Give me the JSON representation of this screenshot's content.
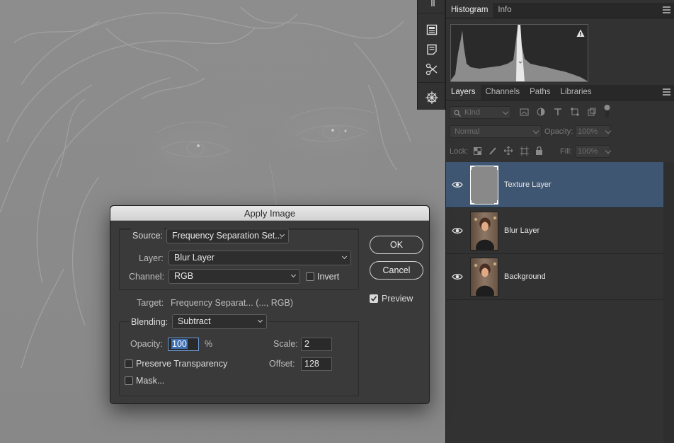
{
  "panels": {
    "histogram_tabs": [
      {
        "label": "Histogram",
        "active": true
      },
      {
        "label": "Info",
        "active": false
      }
    ],
    "layers_tabs": [
      {
        "label": "Layers",
        "active": true
      },
      {
        "label": "Channels",
        "active": false
      },
      {
        "label": "Paths",
        "active": false
      },
      {
        "label": "Libraries",
        "active": false
      }
    ],
    "filter_kind": "Kind",
    "blend_mode": "Normal",
    "opacity_label": "Opacity:",
    "opacity_value": "100%",
    "lock_label": "Lock:",
    "fill_label": "Fill:",
    "fill_value": "100%",
    "layers": [
      {
        "name": "Texture Layer",
        "selected": true,
        "thumb": "gray"
      },
      {
        "name": "Blur Layer",
        "selected": false,
        "thumb": "photo"
      },
      {
        "name": "Background",
        "selected": false,
        "thumb": "photo"
      }
    ]
  },
  "dialog": {
    "title": "Apply Image",
    "source_label": "Source:",
    "source_value": "Frequency Separation Set...",
    "layer_label": "Layer:",
    "layer_value": "Blur Layer",
    "channel_label": "Channel:",
    "channel_value": "RGB",
    "invert_label": "Invert",
    "invert_checked": false,
    "target_label": "Target:",
    "target_value": "Frequency Separat... (..., RGB)",
    "blending_label": "Blending:",
    "blending_value": "Subtract",
    "opacity_label": "Opacity:",
    "opacity_value": "100",
    "opacity_unit": "%",
    "scale_label": "Scale:",
    "scale_value": "2",
    "offset_label": "Offset:",
    "offset_value": "128",
    "preserve_label": "Preserve Transparency",
    "preserve_checked": false,
    "mask_label": "Mask...",
    "mask_checked": false,
    "ok_label": "OK",
    "cancel_label": "Cancel",
    "preview_label": "Preview",
    "preview_checked": true
  },
  "colors": {
    "selected_layer": "#3f5672",
    "canvas_gray": "#8a8a8a",
    "dialog_bg": "#3a3a3a"
  }
}
